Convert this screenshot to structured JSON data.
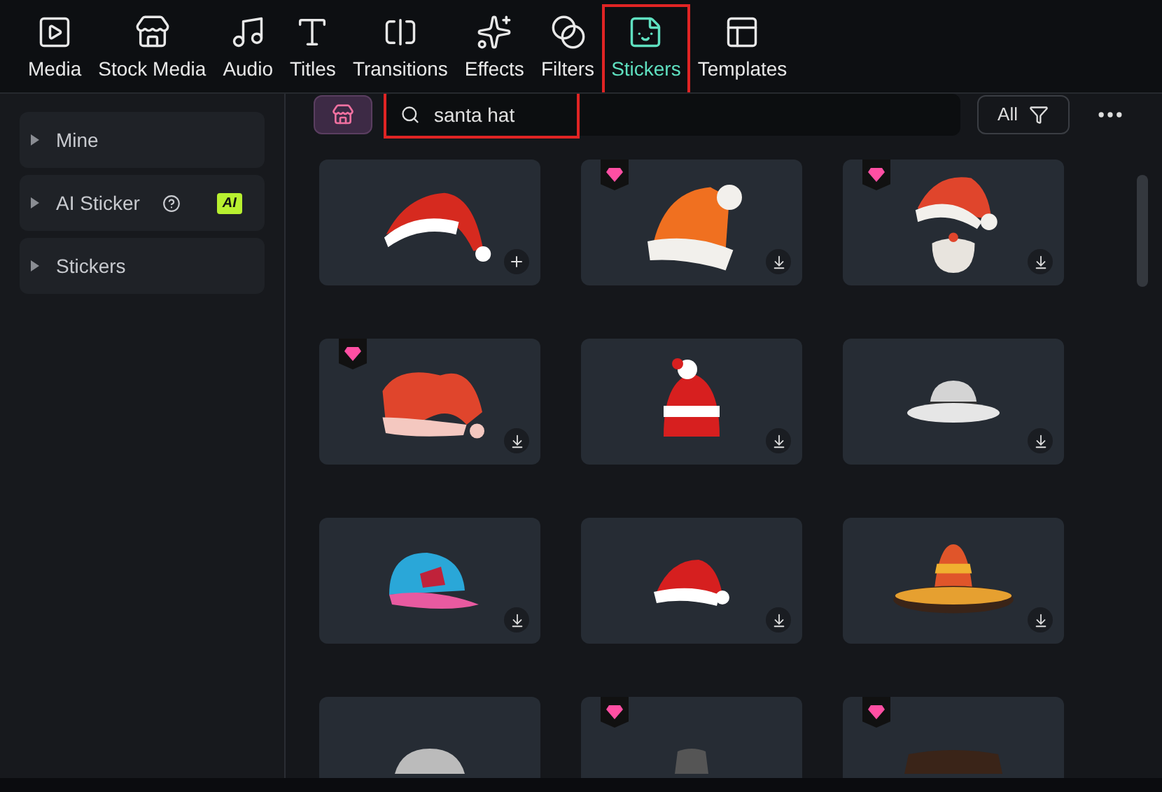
{
  "tabs": [
    {
      "label": "Media",
      "selected": false,
      "highlighted": false
    },
    {
      "label": "Stock Media",
      "selected": false,
      "highlighted": false
    },
    {
      "label": "Audio",
      "selected": false,
      "highlighted": false
    },
    {
      "label": "Titles",
      "selected": false,
      "highlighted": false
    },
    {
      "label": "Transitions",
      "selected": false,
      "highlighted": false
    },
    {
      "label": "Effects",
      "selected": false,
      "highlighted": false
    },
    {
      "label": "Filters",
      "selected": false,
      "highlighted": false
    },
    {
      "label": "Stickers",
      "selected": true,
      "highlighted": true
    },
    {
      "label": "Templates",
      "selected": false,
      "highlighted": false
    }
  ],
  "sidebar": {
    "items": [
      {
        "label": "Mine",
        "expanded": false,
        "help": false
      },
      {
        "label": "AI Sticker",
        "expanded": false,
        "help": true,
        "badge": "AI"
      },
      {
        "label": "Stickers",
        "expanded": false,
        "help": false
      }
    ]
  },
  "search": {
    "value": "santa hat",
    "highlighted": true
  },
  "filter": {
    "label": "All"
  },
  "stickers": [
    {
      "premium": false,
      "kind": "add"
    },
    {
      "premium": true,
      "kind": "download"
    },
    {
      "premium": true,
      "kind": "download"
    },
    {
      "premium": true,
      "kind": "download"
    },
    {
      "premium": false,
      "kind": "download"
    },
    {
      "premium": false,
      "kind": "download"
    },
    {
      "premium": false,
      "kind": "download"
    },
    {
      "premium": false,
      "kind": "download"
    },
    {
      "premium": false,
      "kind": "download"
    },
    {
      "premium": false,
      "kind": "partial"
    },
    {
      "premium": true,
      "kind": "partial"
    },
    {
      "premium": true,
      "kind": "partial"
    }
  ]
}
